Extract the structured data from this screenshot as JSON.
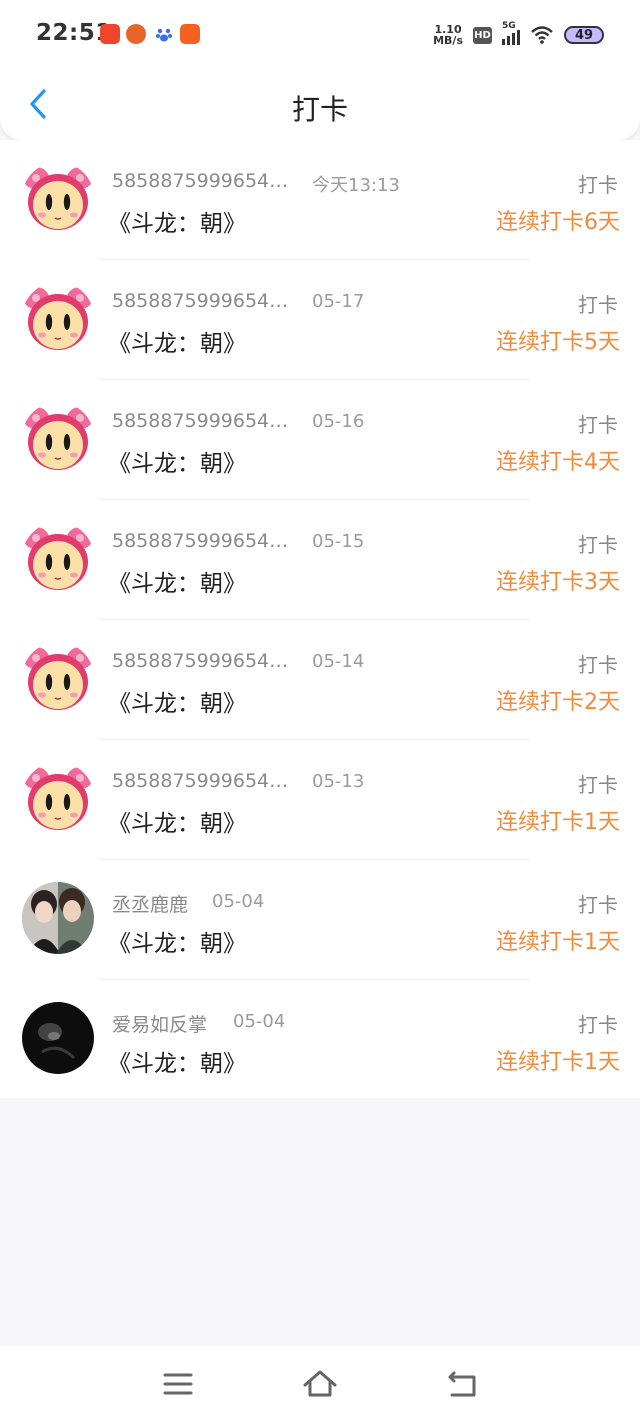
{
  "status_bar": {
    "time": "22:51",
    "net_speed_value": "1.10",
    "net_speed_unit": "MB/s",
    "hd_label": "HD",
    "signal_label": "5G",
    "battery": "49"
  },
  "header": {
    "title": "打卡",
    "back_icon": "chevron-left-icon",
    "accent": "#2196f3"
  },
  "records": [
    {
      "user": "5858875999654…",
      "date": "今天13:13",
      "book": "《斗龙：朝》",
      "action": "打卡",
      "streak": "连续打卡6天",
      "avatar": "pink-cartoon-avatar"
    },
    {
      "user": "5858875999654…",
      "date": "05-17",
      "book": "《斗龙：朝》",
      "action": "打卡",
      "streak": "连续打卡5天",
      "avatar": "pink-cartoon-avatar"
    },
    {
      "user": "5858875999654…",
      "date": "05-16",
      "book": "《斗龙：朝》",
      "action": "打卡",
      "streak": "连续打卡4天",
      "avatar": "pink-cartoon-avatar"
    },
    {
      "user": "5858875999654…",
      "date": "05-15",
      "book": "《斗龙：朝》",
      "action": "打卡",
      "streak": "连续打卡3天",
      "avatar": "pink-cartoon-avatar"
    },
    {
      "user": "5858875999654…",
      "date": "05-14",
      "book": "《斗龙：朝》",
      "action": "打卡",
      "streak": "连续打卡2天",
      "avatar": "pink-cartoon-avatar"
    },
    {
      "user": "5858875999654…",
      "date": "05-13",
      "book": "《斗龙：朝》",
      "action": "打卡",
      "streak": "连续打卡1天",
      "avatar": "pink-cartoon-avatar"
    },
    {
      "user": "丞丞鹿鹿",
      "date": "05-04",
      "book": "《斗龙：朝》",
      "action": "打卡",
      "streak": "连续打卡1天",
      "avatar": "photo-avatar"
    },
    {
      "user": "爱易如反掌",
      "date": "05-04",
      "book": "《斗龙：朝》",
      "action": "打卡",
      "streak": "连续打卡1天",
      "avatar": "dark-photo-avatar"
    }
  ],
  "colors": {
    "streak": "#f08a3c",
    "secondary_text": "#8a8a8a",
    "background": "#f6f5f7"
  },
  "nav_bar": {
    "menu_icon": "menu-icon",
    "home_icon": "home-icon",
    "back_icon": "back-icon"
  }
}
